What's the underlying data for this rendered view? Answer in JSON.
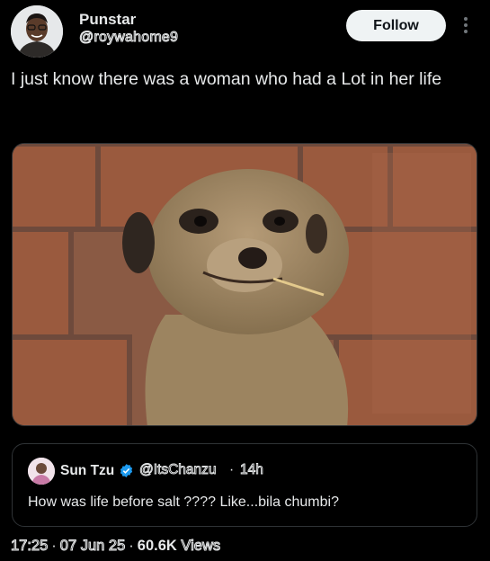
{
  "post": {
    "author_name": "Punstar",
    "author_handle": "@roywahome9",
    "follow_label": "Follow",
    "text": "I just know there was a woman who had a Lot in her life",
    "time": "17:25",
    "date": "07 Jun 25",
    "views_count": "60.6K",
    "views_label": "Views"
  },
  "quote": {
    "author_name": "Sun Tzu",
    "author_handle": "@ItsChanzu",
    "dot": "·",
    "time_ago": "14h",
    "text": "How was life before salt ???? Like...bila chumbi?"
  },
  "icons": {
    "more": "more-vertical-icon",
    "verified": "verified-badge-icon"
  },
  "colors": {
    "background": "#000000",
    "text": "#e7e9ea",
    "verified": "#1d9bf0",
    "follow_bg": "#eff3f4"
  }
}
